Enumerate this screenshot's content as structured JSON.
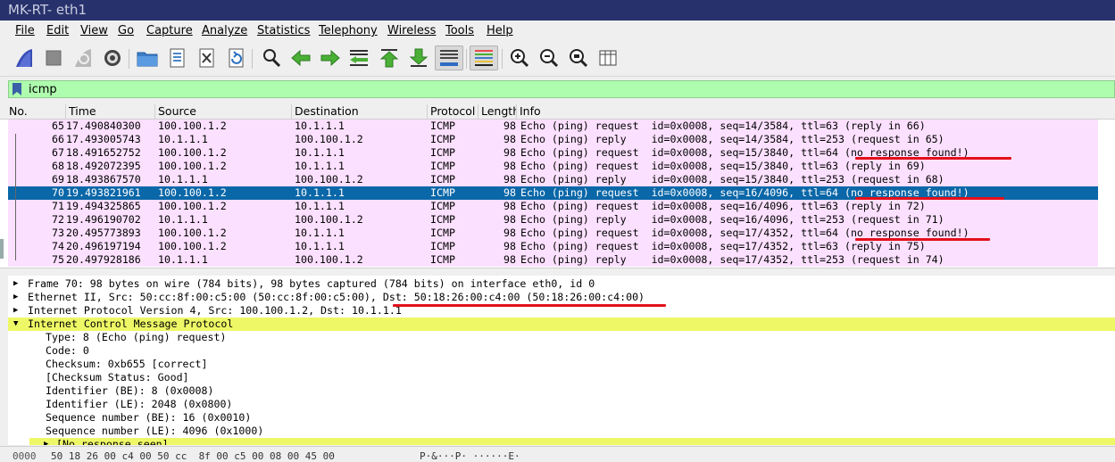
{
  "window": {
    "title": "MK-RT- eth1"
  },
  "menu": [
    "File",
    "Edit",
    "View",
    "Go",
    "Capture",
    "Analyze",
    "Statistics",
    "Telephony",
    "Wireless",
    "Tools",
    "Help"
  ],
  "toolbar": {
    "icons": [
      "shark-fin-start-icon",
      "stop-capture-icon",
      "restart-capture-icon",
      "capture-options-gear-icon",
      "open-file-icon",
      "save-file-icon",
      "close-file-icon",
      "reload-file-icon",
      "find-packet-icon",
      "go-back-icon",
      "go-forward-icon",
      "go-to-packet-icon",
      "go-first-icon",
      "go-last-icon",
      "autoscroll-icon",
      "colorize-icon",
      "zoom-in-icon",
      "zoom-out-icon",
      "zoom-normal-icon",
      "resize-columns-icon"
    ]
  },
  "filter": {
    "value": "icmp"
  },
  "columns": [
    "No.",
    "Time",
    "Source",
    "Destination",
    "Protocol",
    "Length",
    "Info"
  ],
  "packets": [
    {
      "no": "65",
      "time": "17.490840300",
      "src": "100.100.1.2",
      "dst": "10.1.1.1",
      "proto": "ICMP",
      "len": "98",
      "info": "Echo (ping) request  id=0x0008, seq=14/3584, ttl=63 (reply in 66)"
    },
    {
      "no": "66",
      "time": "17.493005743",
      "src": "10.1.1.1",
      "dst": "100.100.1.2",
      "proto": "ICMP",
      "len": "98",
      "info": "Echo (ping) reply    id=0x0008, seq=14/3584, ttl=253 (request in 65)"
    },
    {
      "no": "67",
      "time": "18.491652752",
      "src": "100.100.1.2",
      "dst": "10.1.1.1",
      "proto": "ICMP",
      "len": "98",
      "info": "Echo (ping) request  id=0x0008, seq=15/3840, ttl=64 (no response found!)"
    },
    {
      "no": "68",
      "time": "18.492072395",
      "src": "100.100.1.2",
      "dst": "10.1.1.1",
      "proto": "ICMP",
      "len": "98",
      "info": "Echo (ping) request  id=0x0008, seq=15/3840, ttl=63 (reply in 69)"
    },
    {
      "no": "69",
      "time": "18.493867570",
      "src": "10.1.1.1",
      "dst": "100.100.1.2",
      "proto": "ICMP",
      "len": "98",
      "info": "Echo (ping) reply    id=0x0008, seq=15/3840, ttl=253 (request in 68)"
    },
    {
      "no": "70",
      "time": "19.493821961",
      "src": "100.100.1.2",
      "dst": "10.1.1.1",
      "proto": "ICMP",
      "len": "98",
      "info": "Echo (ping) request  id=0x0008, seq=16/4096, ttl=64 (no response found!)"
    },
    {
      "no": "71",
      "time": "19.494325865",
      "src": "100.100.1.2",
      "dst": "10.1.1.1",
      "proto": "ICMP",
      "len": "98",
      "info": "Echo (ping) request  id=0x0008, seq=16/4096, ttl=63 (reply in 72)"
    },
    {
      "no": "72",
      "time": "19.496190702",
      "src": "10.1.1.1",
      "dst": "100.100.1.2",
      "proto": "ICMP",
      "len": "98",
      "info": "Echo (ping) reply    id=0x0008, seq=16/4096, ttl=253 (request in 71)"
    },
    {
      "no": "73",
      "time": "20.495773893",
      "src": "100.100.1.2",
      "dst": "10.1.1.1",
      "proto": "ICMP",
      "len": "98",
      "info": "Echo (ping) request  id=0x0008, seq=17/4352, ttl=64 (no response found!)"
    },
    {
      "no": "74",
      "time": "20.496197194",
      "src": "100.100.1.2",
      "dst": "10.1.1.1",
      "proto": "ICMP",
      "len": "98",
      "info": "Echo (ping) request  id=0x0008, seq=17/4352, ttl=63 (reply in 75)"
    },
    {
      "no": "75",
      "time": "20.497928186",
      "src": "10.1.1.1",
      "dst": "100.100.1.2",
      "proto": "ICMP",
      "len": "98",
      "info": "Echo (ping) reply    id=0x0008, seq=17/4352, ttl=253 (request in 74)"
    }
  ],
  "selected_packet": "70",
  "details": [
    {
      "text": "Frame 70: 98 bytes on wire (784 bits), 98 bytes captured (784 bits) on interface eth0, id 0",
      "expand": "collapsed",
      "indent": 0
    },
    {
      "text": "Ethernet II, Src: 50:cc:8f:00:c5:00 (50:cc:8f:00:c5:00), Dst: 50:18:26:00:c4:00 (50:18:26:00:c4:00)",
      "expand": "collapsed",
      "indent": 0
    },
    {
      "text": "Internet Protocol Version 4, Src: 100.100.1.2, Dst: 10.1.1.1",
      "expand": "collapsed",
      "indent": 0
    },
    {
      "text": "Internet Control Message Protocol",
      "expand": "expanded",
      "indent": 0,
      "highlight": true
    },
    {
      "text": "Type: 8 (Echo (ping) request)",
      "expand": "none",
      "indent": 1
    },
    {
      "text": "Code: 0",
      "expand": "none",
      "indent": 1
    },
    {
      "text": "Checksum: 0xb655 [correct]",
      "expand": "none",
      "indent": 1
    },
    {
      "text": "[Checksum Status: Good]",
      "expand": "none",
      "indent": 1
    },
    {
      "text": "Identifier (BE): 8 (0x0008)",
      "expand": "none",
      "indent": 1
    },
    {
      "text": "Identifier (LE): 2048 (0x0800)",
      "expand": "none",
      "indent": 1
    },
    {
      "text": "Sequence number (BE): 16 (0x0010)",
      "expand": "none",
      "indent": 1
    },
    {
      "text": "Sequence number (LE): 4096 (0x1000)",
      "expand": "none",
      "indent": 1
    },
    {
      "text": "[No response seen]",
      "expand": "collapsed",
      "indent": 1,
      "highlight": true
    }
  ],
  "bytes_preview": {
    "offset": "0000",
    "hex": "50 18 26 00 c4 00 50 cc  8f 00 c5 00 08 00 45 00",
    "ascii": "P·&···P· ······E·"
  },
  "colors": {
    "titlebar": "#27316b",
    "row": "#fce0ff",
    "selected": "#0a67a8",
    "filter": "#aefcae",
    "highlight": "#eef866",
    "annotation": "#e4101c"
  }
}
